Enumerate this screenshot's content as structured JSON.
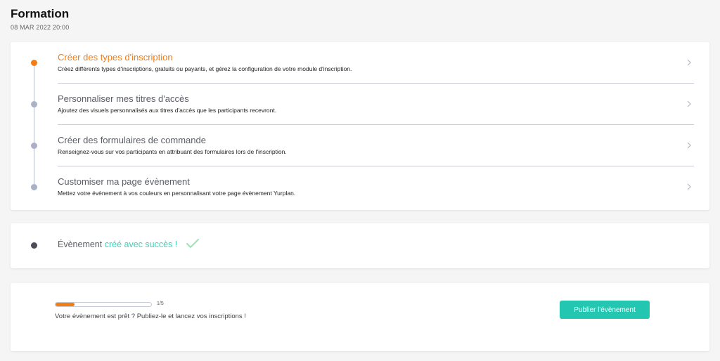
{
  "header": {
    "title": "Formation",
    "date": "08 MAR 2022 20:00"
  },
  "steps": [
    {
      "title": "Créer des types d'inscription",
      "description": "Créez différents types d'inscriptions, gratuits ou payants, et gérez la configuration de votre module d'inscription.",
      "active": true
    },
    {
      "title": "Personnaliser mes titres d'accès",
      "description": "Ajoutez des visuels personnalisés aux titres d'accès que les participants recevront.",
      "active": false
    },
    {
      "title": "Créer des formulaires de commande",
      "description": "Renseignez-vous sur vos participants en attribuant des formulaires lors de l'inscription.",
      "active": false
    },
    {
      "title": "Customiser ma page évènement",
      "description": "Mettez votre évènement à vos couleurs en personnalisant votre page évènement Yurplan.",
      "active": false
    }
  ],
  "success": {
    "prefix": "Évènement",
    "accent": "créé avec succès !",
    "icon": "check-icon"
  },
  "publish": {
    "progress_fraction": 0.2,
    "progress_label": "1/5",
    "message": "Votre évènement est prêt ? Publiez-le et lancez vos inscriptions !",
    "button_label": "Publier l'évènement"
  },
  "colors": {
    "accent": "#f07d18",
    "success": "#3fd1b8",
    "button": "#23c6b0"
  }
}
